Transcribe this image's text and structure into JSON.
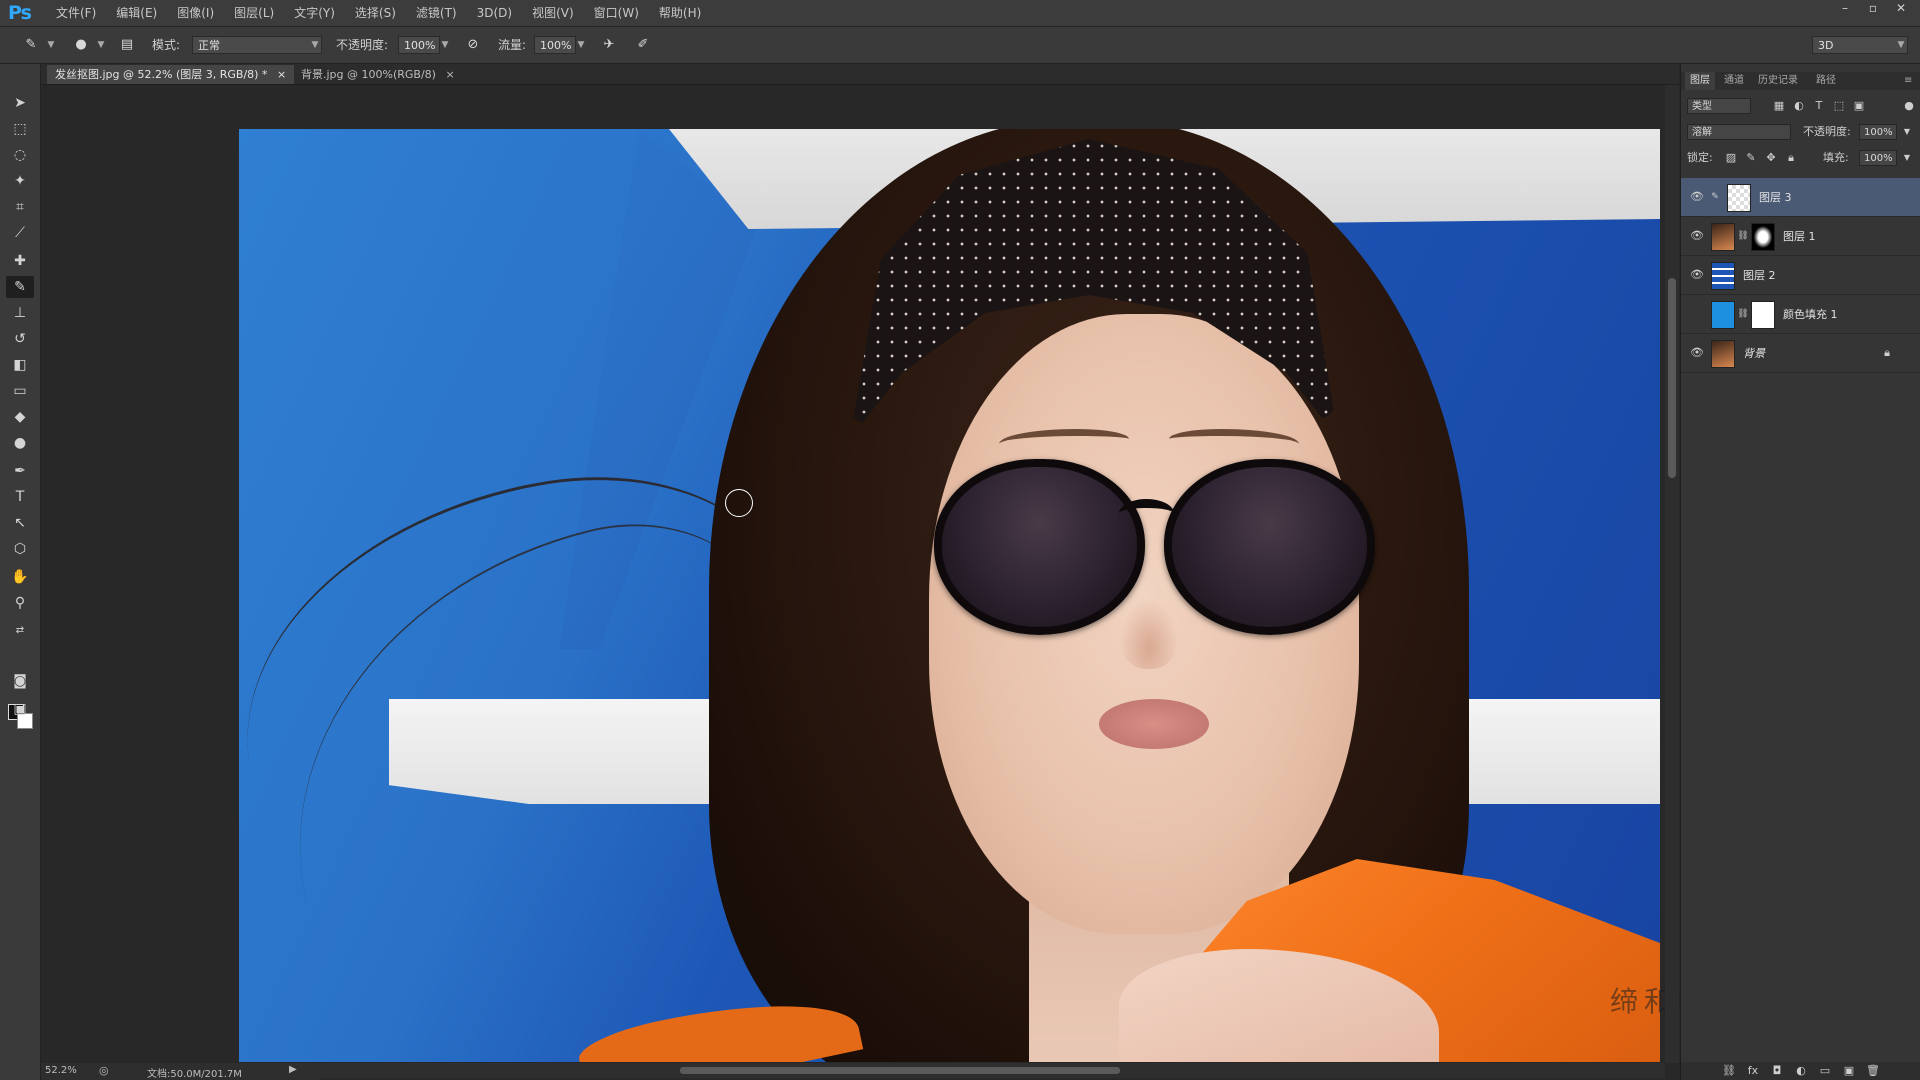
{
  "app": {
    "logo": "Ps"
  },
  "menu": [
    "文件(F)",
    "编辑(E)",
    "图像(I)",
    "图层(L)",
    "文字(Y)",
    "选择(S)",
    "滤镜(T)",
    "3D(D)",
    "视图(V)",
    "窗口(W)",
    "帮助(H)"
  ],
  "window_controls": {
    "minimize": "–",
    "restore": "▫",
    "close": "✕"
  },
  "options": {
    "mode_label": "模式:",
    "mode_value": "正常",
    "opacity_label": "不透明度:",
    "opacity_value": "100%",
    "flow_label": "流量:",
    "flow_value": "100%",
    "workspace_value": "3D"
  },
  "tabs": [
    {
      "label": "发丝抠图.jpg @ 52.2% (图层 3, RGB/8) *",
      "close": "×"
    },
    {
      "label": "背景.jpg @ 100%(RGB/8)",
      "close": "×"
    }
  ],
  "tools": [
    "move-icon",
    "marquee-icon",
    "lasso-icon",
    "magic-wand-icon",
    "crop-icon",
    "eyedropper-icon",
    "healing-icon",
    "brush-icon",
    "stamp-icon",
    "history-brush-icon",
    "eraser-icon",
    "gradient-icon",
    "blur-icon",
    "dodge-icon",
    "pen-icon",
    "type-icon",
    "path-select-icon",
    "shape-icon",
    "hand-icon",
    "zoom-icon"
  ],
  "status": {
    "zoom": "52.2%",
    "doc": "文档:50.0M/201.7M"
  },
  "watermark": "缔和摄影后期教程",
  "layers_panel": {
    "tabs": [
      "图层",
      "通道",
      "历史记录",
      "路径"
    ],
    "filter_label": "类型",
    "blend_mode": "溶解",
    "opacity_label": "不透明度:",
    "opacity_value": "100%",
    "lock_label": "锁定:",
    "fill_label": "填充:",
    "fill_value": "100%",
    "layers": [
      {
        "name": "图层 3",
        "visible": true,
        "selected": true
      },
      {
        "name": "图层 1",
        "visible": true,
        "selected": false
      },
      {
        "name": "图层 2",
        "visible": true,
        "selected": false
      },
      {
        "name": "颜色填充 1",
        "visible": false,
        "selected": false
      },
      {
        "name": "背景",
        "visible": true,
        "selected": false
      }
    ]
  },
  "colors": {
    "accent": "#31a8ff",
    "selected_layer": "#4a5a74",
    "canvas_blue": "#1d56b5",
    "jacket_orange": "#f07018"
  }
}
